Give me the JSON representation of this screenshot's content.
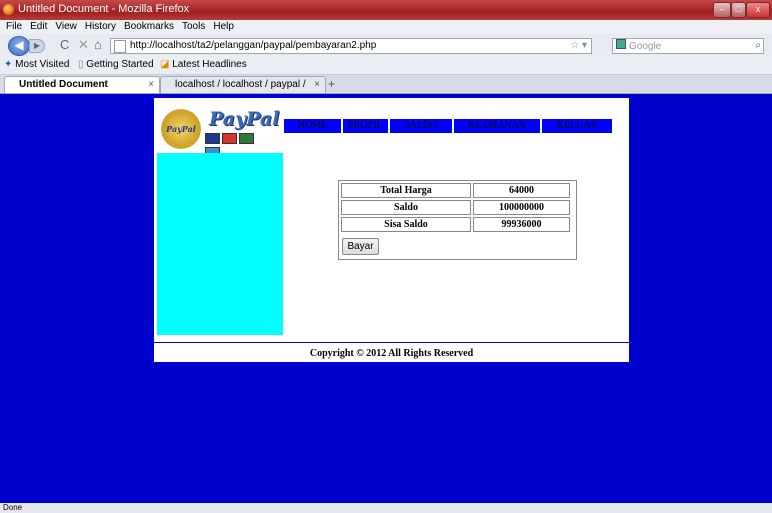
{
  "window": {
    "title": "Untitled Document - Mozilla Firefox"
  },
  "menubar": {
    "items": [
      "File",
      "Edit",
      "View",
      "History",
      "Bookmarks",
      "Tools",
      "Help"
    ]
  },
  "navbar": {
    "url": "http://localhost/ta2/pelanggan/paypal/pembayaran2.php",
    "search_placeholder": "Google"
  },
  "bookmarks": {
    "items": [
      "Most Visited",
      "Getting Started",
      "Latest Headlines"
    ]
  },
  "tabs": [
    {
      "label": "Untitled Document",
      "active": true
    },
    {
      "label": "localhost / localhost / paypal / pen...",
      "active": false
    }
  ],
  "page": {
    "logo_text": "PayPal",
    "seal_text": "PayPal",
    "nav": [
      "HOME",
      "PROFIL",
      "SALDO",
      "KEAMANAN",
      "KELUAR"
    ],
    "payment": {
      "rows": [
        {
          "label": "Total Harga",
          "value": "64000"
        },
        {
          "label": "Saldo",
          "value": "100000000"
        },
        {
          "label": "Sisa Saldo",
          "value": "99936000"
        }
      ],
      "button_label": "Bayar"
    },
    "footer": "Copyright © 2012 All Rights Reserved"
  },
  "status_bar": {
    "text": "Done"
  },
  "colors": {
    "background": "#0000cc",
    "menu": "#0000ff",
    "sidebar": "#00ffff"
  }
}
